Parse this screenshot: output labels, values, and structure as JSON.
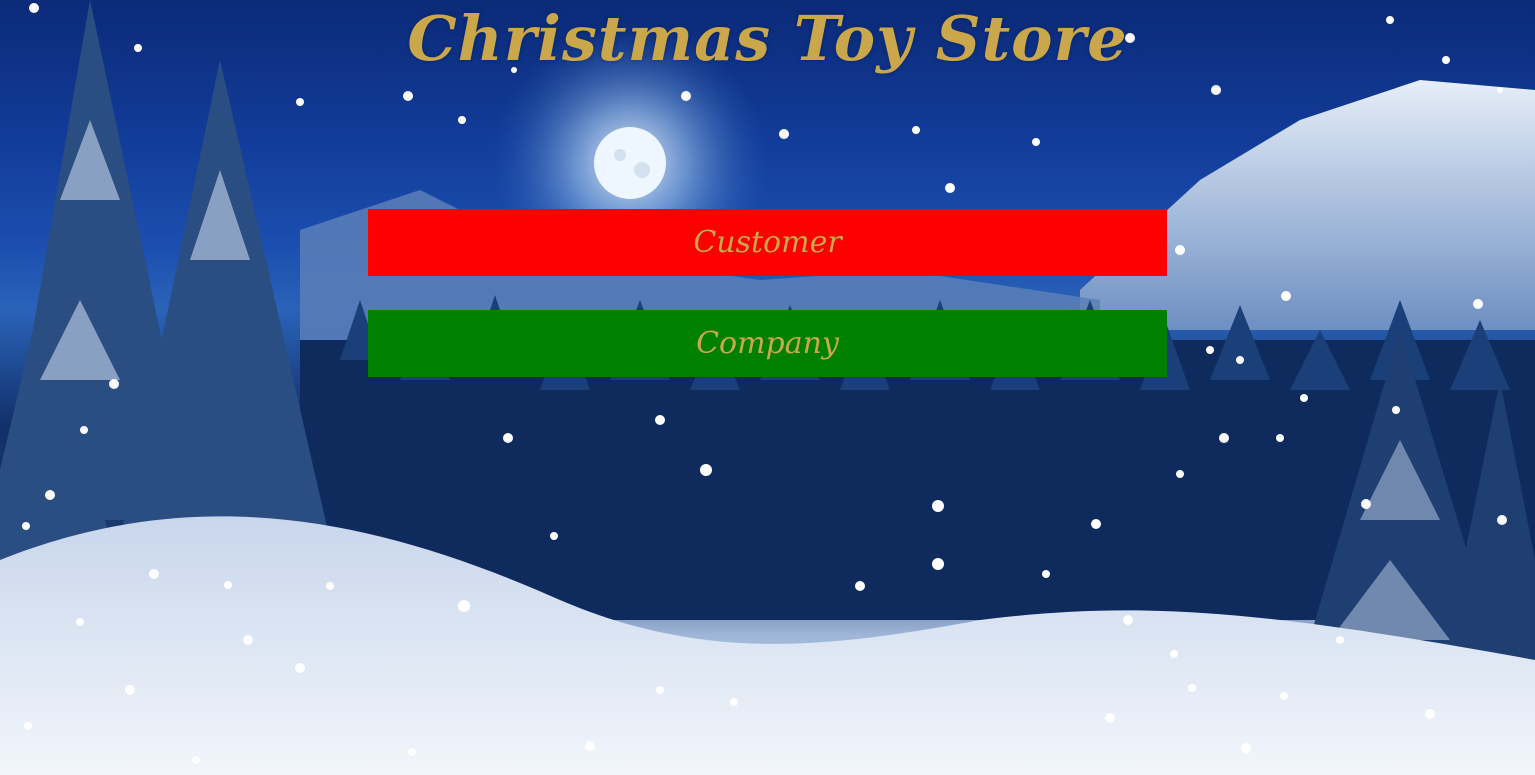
{
  "page": {
    "title": "Christmas Toy Store"
  },
  "buttons": {
    "customer": {
      "label": "Customer",
      "color": "#ff0000"
    },
    "company": {
      "label": "Company",
      "color": "#008000"
    }
  },
  "theme": {
    "title_color": "#c9a74a",
    "label_color": "#c9a74a"
  },
  "background": {
    "scene": "snowy-night-landscape",
    "elements": [
      "moon-icon",
      "mountain-range",
      "pine-forest",
      "snowflakes"
    ]
  }
}
